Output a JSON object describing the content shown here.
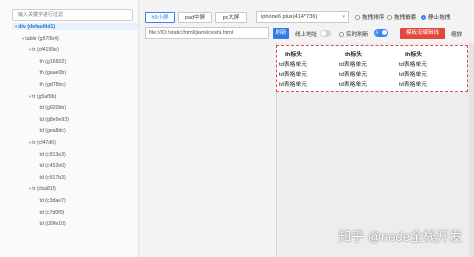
{
  "search": {
    "placeholder": "输入关键字进行过滤"
  },
  "tree": [
    {
      "label": "div (defaultId1)",
      "arrow": "▾",
      "root": true
    },
    {
      "label": "table (g570b4)",
      "arrow": "▾"
    },
    {
      "label": "tr (cf4199e)",
      "arrow": "▾"
    },
    {
      "label": "th (g16602)",
      "arrow": ""
    },
    {
      "label": "th (gaae0b)",
      "arrow": ""
    },
    {
      "label": "th (gd78bc)",
      "arrow": ""
    },
    {
      "label": "tr (g5af9b)",
      "arrow": "▾"
    },
    {
      "label": "td (g920bb)",
      "arrow": ""
    },
    {
      "label": "td (g8e9e93)",
      "arrow": ""
    },
    {
      "label": "td (gea8dc)",
      "arrow": ""
    },
    {
      "label": "tr (cf47d6)",
      "arrow": "▾"
    },
    {
      "label": "td (c913e3)",
      "arrow": ""
    },
    {
      "label": "td (c452e0)",
      "arrow": ""
    },
    {
      "label": "td (c917b3)",
      "arrow": ""
    },
    {
      "label": "tr (cba81f)",
      "arrow": "▾"
    },
    {
      "label": "td (c3dae7)",
      "arrow": ""
    },
    {
      "label": "td (c7d0f9)",
      "arrow": ""
    },
    {
      "label": "td (i39fe10)",
      "arrow": ""
    }
  ],
  "devices": {
    "small": "h5小屏",
    "medium": "pad中屏",
    "large": "pc大屏"
  },
  "device_select": "iphone6 plus(414*736)",
  "radios": {
    "drag_sort": "拖拽排序",
    "drag_nest": "拖拽嵌套",
    "static_sort": "静止拖拽"
  },
  "url": "file:///D:/static/html/jiami/ceshi.html",
  "buttons": {
    "refresh": "刷新",
    "online_label": "线上地址",
    "realtime": "实时刷新",
    "toggle_on": "开",
    "template": "模板没编辑线",
    "zoom": "缩放"
  },
  "table": {
    "headers": [
      "th标头",
      "th标头",
      "th标头"
    ],
    "rows": [
      [
        "td表格单元",
        "td表格单元",
        "td表格单元"
      ],
      [
        "td表格单元",
        "td表格单元",
        "td表格单元"
      ],
      [
        "td表格单元",
        "td表格单元",
        "td表格单元"
      ]
    ]
  },
  "watermark": "知乎 @node全栈开发"
}
